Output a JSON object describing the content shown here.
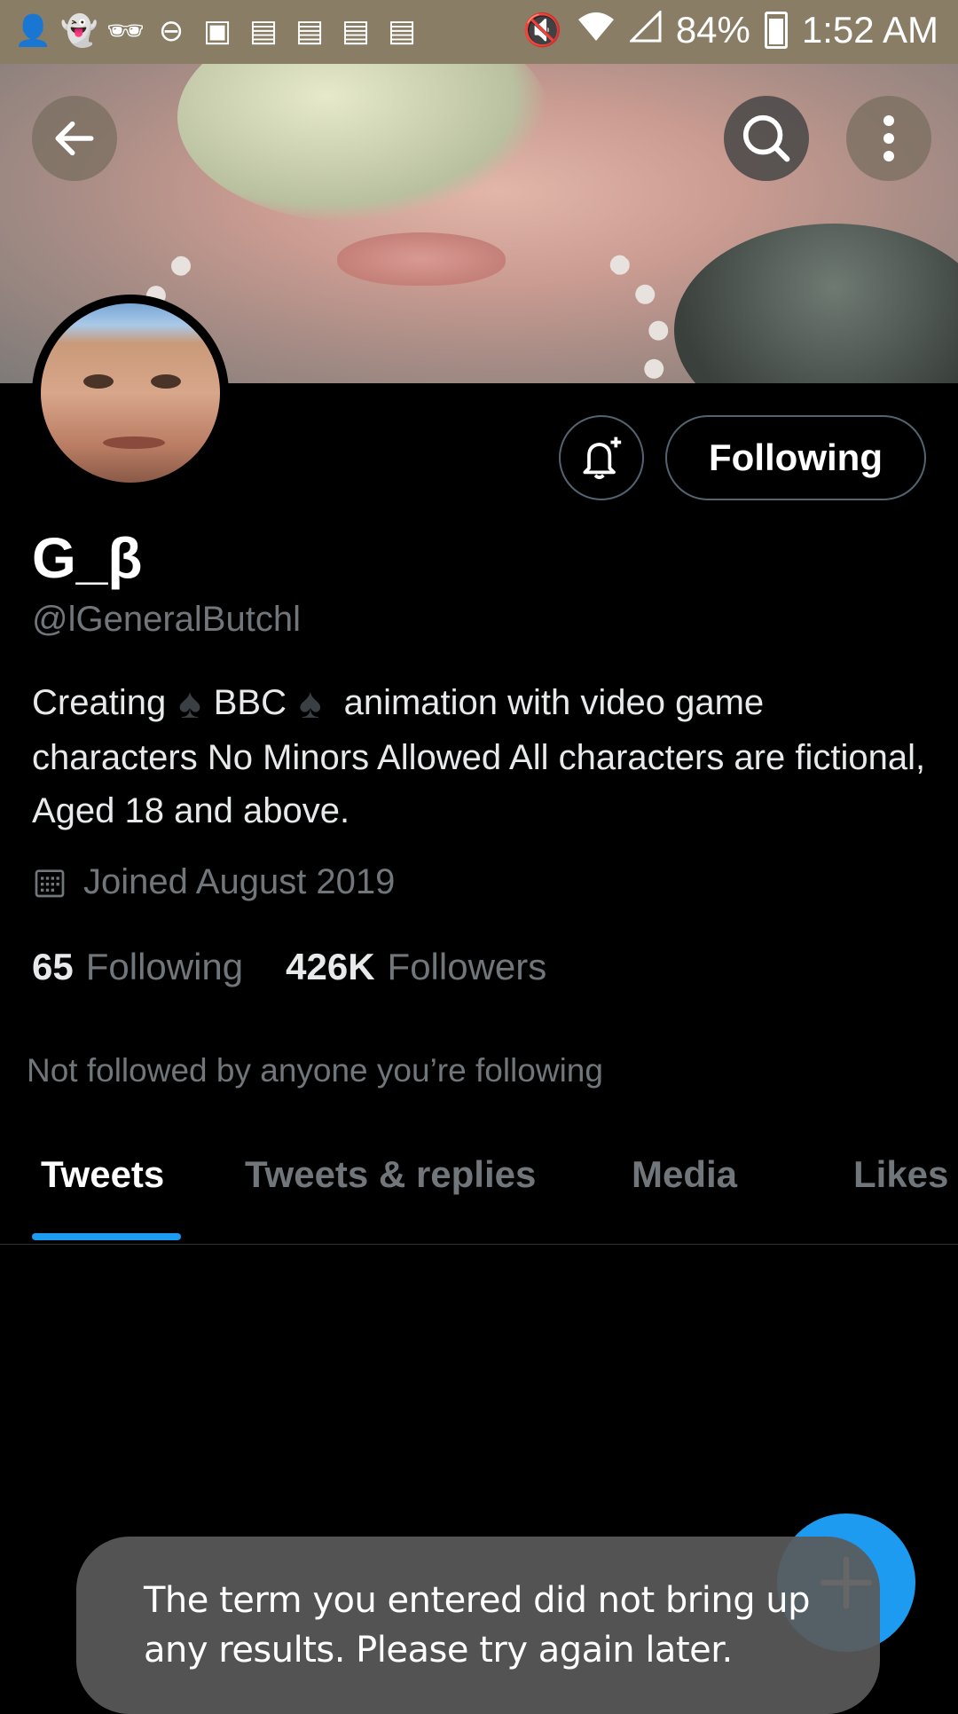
{
  "status_bar": {
    "battery": "84%",
    "time": "1:52 AM",
    "icons": [
      "add-person-icon",
      "snapchat-icon",
      "incognito-icon",
      "do-not-disturb-icon",
      "screenshot-icon",
      "calendar-icon",
      "calendar-icon",
      "calendar-icon",
      "calendar-icon",
      "mute-icon",
      "wifi-icon",
      "cell-signal-icon",
      "battery-icon"
    ]
  },
  "header": {
    "back_icon": "arrow-left-icon",
    "search_icon": "search-icon",
    "more_icon": "more-vertical-icon"
  },
  "profile": {
    "display_name": "G_β",
    "handle": "@lGeneralButchl",
    "bio_parts": [
      "Creating",
      "BBC",
      "animation with video game characters No Minors Allowed  All characters are fictional, Aged 18 and above."
    ],
    "joined": "Joined August 2019",
    "following_count": "65",
    "following_label": "Following",
    "followers_count": "426K",
    "followers_label": "Followers",
    "not_followed_text": "Not followed by anyone you’re following"
  },
  "actions": {
    "follow_button_label": "Following",
    "bell_icon": "bell-plus-icon"
  },
  "tabs": [
    {
      "label": "Tweets",
      "active": true
    },
    {
      "label": "Tweets & replies",
      "active": false
    },
    {
      "label": "Media",
      "active": false
    },
    {
      "label": "Likes",
      "active": false
    }
  ],
  "toast": {
    "line1": "The term you entered did not bring up",
    "line2": "any results. Please try again later."
  },
  "colors": {
    "accent": "#1d9bf0",
    "muted_text": "#71767b",
    "border": "#536471",
    "status_bar": "#8a7d66"
  }
}
